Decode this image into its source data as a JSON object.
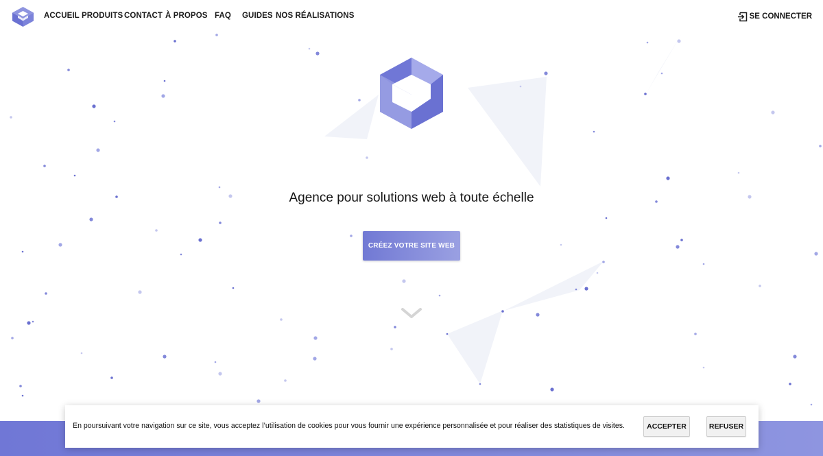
{
  "brand": {
    "accent": "#6f76d4",
    "accent_light": "#9aa0e2",
    "logo_icon": "cube-logo-icon"
  },
  "nav": {
    "items": [
      {
        "label": "ACCUEIL"
      },
      {
        "label": "PRODUITS"
      },
      {
        "label": "CONTACT"
      },
      {
        "label": "À PROPOS"
      },
      {
        "label": "FAQ"
      },
      {
        "label": "GUIDES"
      },
      {
        "label": "NOS RÉALISATIONS"
      }
    ],
    "login_label": "SE CONNECTER",
    "login_icon": "sign-in-icon"
  },
  "hero": {
    "tagline": "Agence pour solutions web à toute échelle",
    "cta_label": "CRÉEZ VOTRE SITE WEB",
    "scroll_icon": "chevron-down-icon"
  },
  "cookie_banner": {
    "text": "En poursuivant votre navigation sur ce site, vous acceptez l’utilisation de cookies pour vous fournir une expérience personnalisée et pour réaliser des statistiques de visites.",
    "accept_label": "ACCEPTER",
    "refuse_label": "REFUSER"
  }
}
